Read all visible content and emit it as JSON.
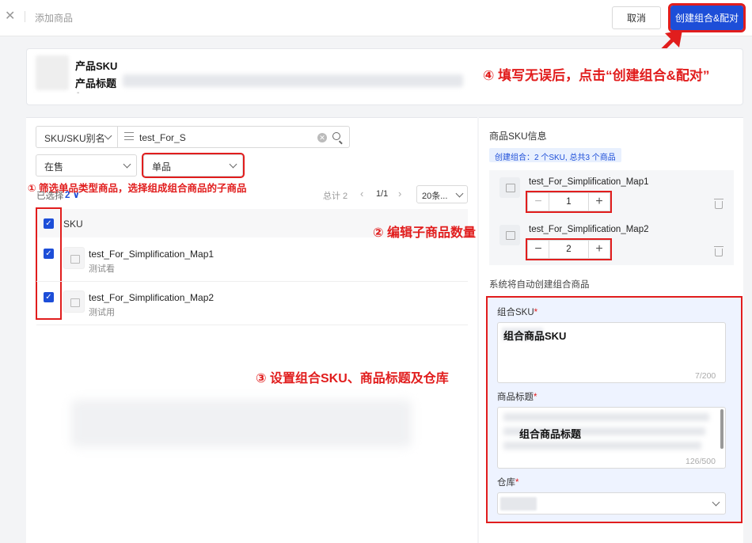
{
  "topbar": {
    "close_icon": "close-icon",
    "page_title": "添加商品",
    "cancel_label": "取消",
    "create_label": "创建组合&配对"
  },
  "product": {
    "sku_label": "产品SKU",
    "title_label": "产品标题",
    "dash": "-"
  },
  "annotations": {
    "step1": "① 筛选单品类型商品，选择组成组合商品的子商品",
    "step2": "② 编辑子商品数量",
    "step3": "③ 设置组合SKU、商品标题及仓库",
    "step4": "④ 填写无误后，点击“创建组合&配对”"
  },
  "filters": {
    "search_type": "SKU/SKU别名",
    "search_value": "test_For_S",
    "status": "在售",
    "kind": "单品"
  },
  "list": {
    "selected_label": "已选择",
    "selected_count": "2",
    "total_label": "总计 2",
    "page_text": "1/1",
    "page_size": "20条...",
    "column_header": "SKU",
    "rows": [
      {
        "name": "test_For_Simplification_Map1",
        "sub": "测试看",
        "checked": true
      },
      {
        "name": "test_For_Simplification_Map2",
        "sub": "测试用",
        "checked": true
      }
    ]
  },
  "right": {
    "title": "商品SKU信息",
    "tag": "创建组合：2 个SKU, 总共3 个商品",
    "items": [
      {
        "name": "test_For_Simplification_Map1",
        "qty": "1"
      },
      {
        "name": "test_For_Simplification_Map2",
        "qty": "2"
      }
    ],
    "auto_label": "系统将自动创建组合商品",
    "combo_sku_label": "组合SKU",
    "combo_sku_value": "组合商品SKU",
    "combo_sku_count": "7/200",
    "title_label": "商品标题",
    "title_value": "组合商品标题",
    "title_count": "126/500",
    "warehouse_label": "仓库",
    "required_mark": "*"
  },
  "colors": {
    "accent": "#1d4ed8",
    "annotation": "#e11d1d"
  }
}
